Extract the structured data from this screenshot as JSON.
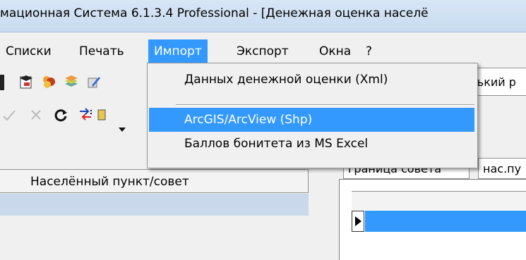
{
  "window": {
    "title": "мационная Система 6.1.3.4 Professional - [Денежная оценка населё"
  },
  "menubar": {
    "items": [
      {
        "label": "Списки"
      },
      {
        "label": "Печать"
      },
      {
        "label": "Импорт",
        "active": true
      },
      {
        "label": "Экспорт"
      },
      {
        "label": "Окна"
      },
      {
        "label": "?"
      }
    ]
  },
  "import_menu": {
    "items": [
      {
        "label": "Данных денежной оценки (Xml)"
      },
      {
        "label": "ArcGIS/ArcView (Shp)",
        "highlighted": true
      },
      {
        "label": "Баллов бонитета из MS Excel"
      }
    ]
  },
  "left_grid": {
    "column_header": "Населённый пункт/совет"
  },
  "right_panel": {
    "field_value": "ський р",
    "tabs": [
      {
        "label": "граница совета"
      },
      {
        "label": "нас.пу"
      }
    ]
  },
  "colors": {
    "accent": "#3399ff",
    "row_highlight": "#c9d8ea"
  }
}
